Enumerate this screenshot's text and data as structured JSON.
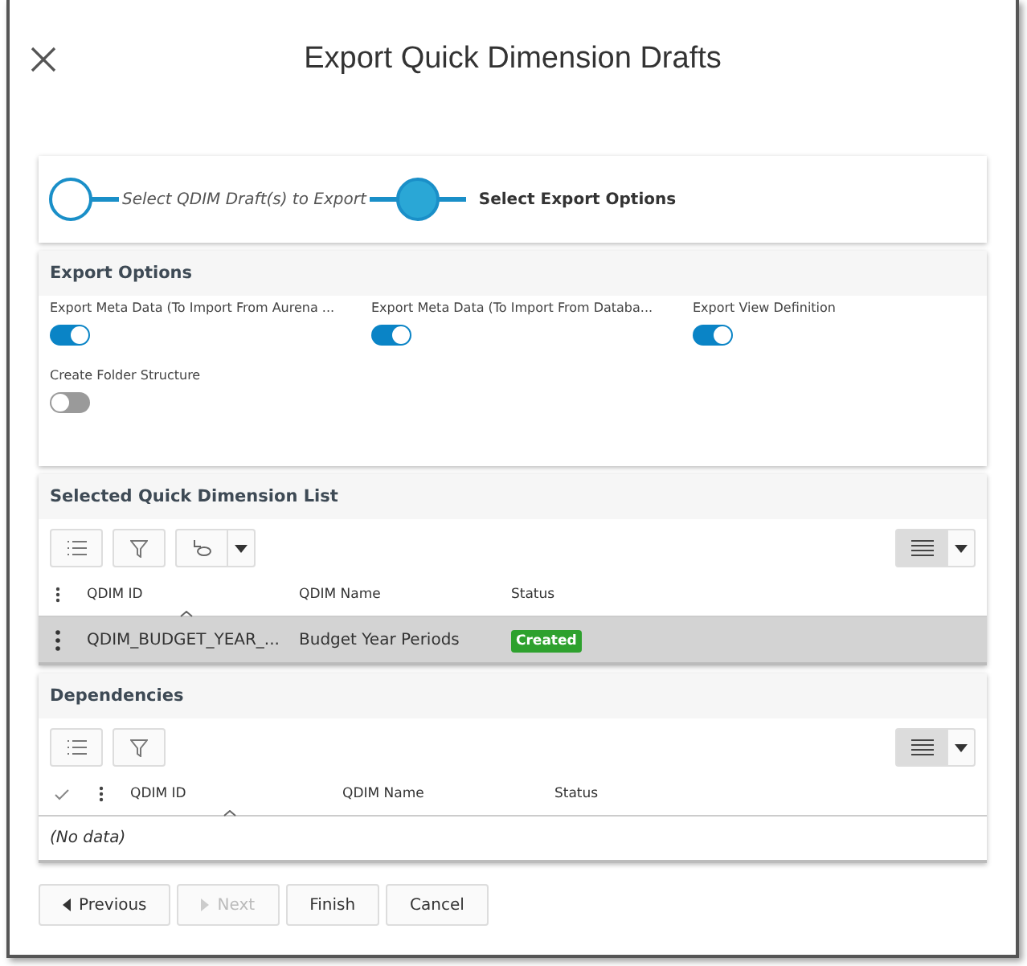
{
  "window": {
    "title": "Export Quick Dimension Drafts"
  },
  "steps": [
    {
      "label": "Select QDIM Draft(s) to Export",
      "selected": false
    },
    {
      "label": "Select Export Options",
      "selected": true
    }
  ],
  "export_options": {
    "title": "Export Options",
    "toggles": [
      {
        "label": "Export Meta Data (To Import From Aurena ...",
        "on": true
      },
      {
        "label": "Export Meta Data (To Import From Databa...",
        "on": true
      },
      {
        "label": "Export View Definition",
        "on": true
      },
      {
        "label": "Create Folder Structure",
        "on": false
      }
    ]
  },
  "selected_list": {
    "title": "Selected Quick Dimension List",
    "columns": [
      "QDIM ID",
      "QDIM Name",
      "Status"
    ],
    "rows": [
      {
        "qdim_id": "QDIM_BUDGET_YEAR_...",
        "qdim_name": "Budget Year Periods",
        "status": "Created",
        "selected": true
      }
    ]
  },
  "dependencies": {
    "title": "Dependencies",
    "columns": [
      "QDIM ID",
      "QDIM Name",
      "Status"
    ],
    "empty": "(No data)"
  },
  "buttons": [
    {
      "label": "Previous",
      "kind": "previous",
      "disabled": false
    },
    {
      "label": "Next",
      "kind": "next",
      "disabled": true
    },
    {
      "label": "Finish",
      "kind": "plain",
      "disabled": false
    },
    {
      "label": "Cancel",
      "kind": "plain",
      "disabled": false
    }
  ]
}
